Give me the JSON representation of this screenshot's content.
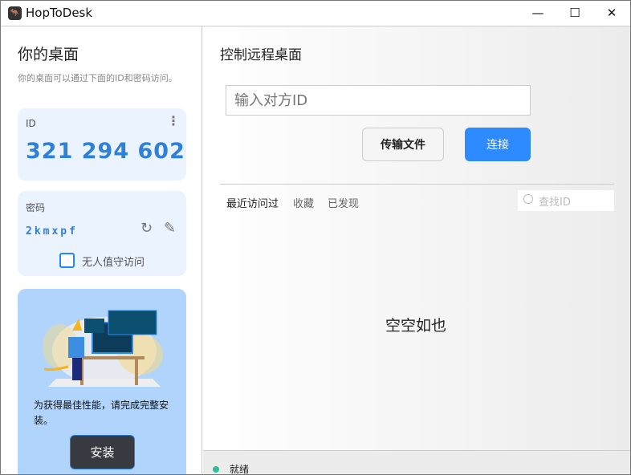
{
  "window": {
    "title": "HopToDesk",
    "controls": {
      "minimize": "—",
      "maximize": "☐",
      "close": "✕"
    }
  },
  "left": {
    "heading": "你的桌面",
    "subtitle": "你的桌面可以通过下面的ID和密码访问。",
    "id_card": {
      "label": "ID",
      "value": "321 294 602"
    },
    "password_card": {
      "label": "密码",
      "value": "2kmxpf",
      "unattended_label": "无人值守访问",
      "unattended_checked": false
    },
    "install_card": {
      "text": "为获得最佳性能，请完成完整安装。",
      "button": "安装"
    }
  },
  "right": {
    "heading": "控制远程桌面",
    "id_input": {
      "placeholder": "输入对方ID",
      "value": ""
    },
    "transfer_button": "传输文件",
    "connect_button": "连接",
    "tabs": [
      {
        "label": "最近访问过",
        "active": true
      },
      {
        "label": "收藏"
      },
      {
        "label": "已发现"
      }
    ],
    "search_placeholder": "查找ID",
    "empty_text": "空空如也"
  },
  "status": {
    "text": "就绪",
    "color": "#2cc09b"
  },
  "colors": {
    "accent": "#2e8bff",
    "id_text": "#2f80d8"
  }
}
